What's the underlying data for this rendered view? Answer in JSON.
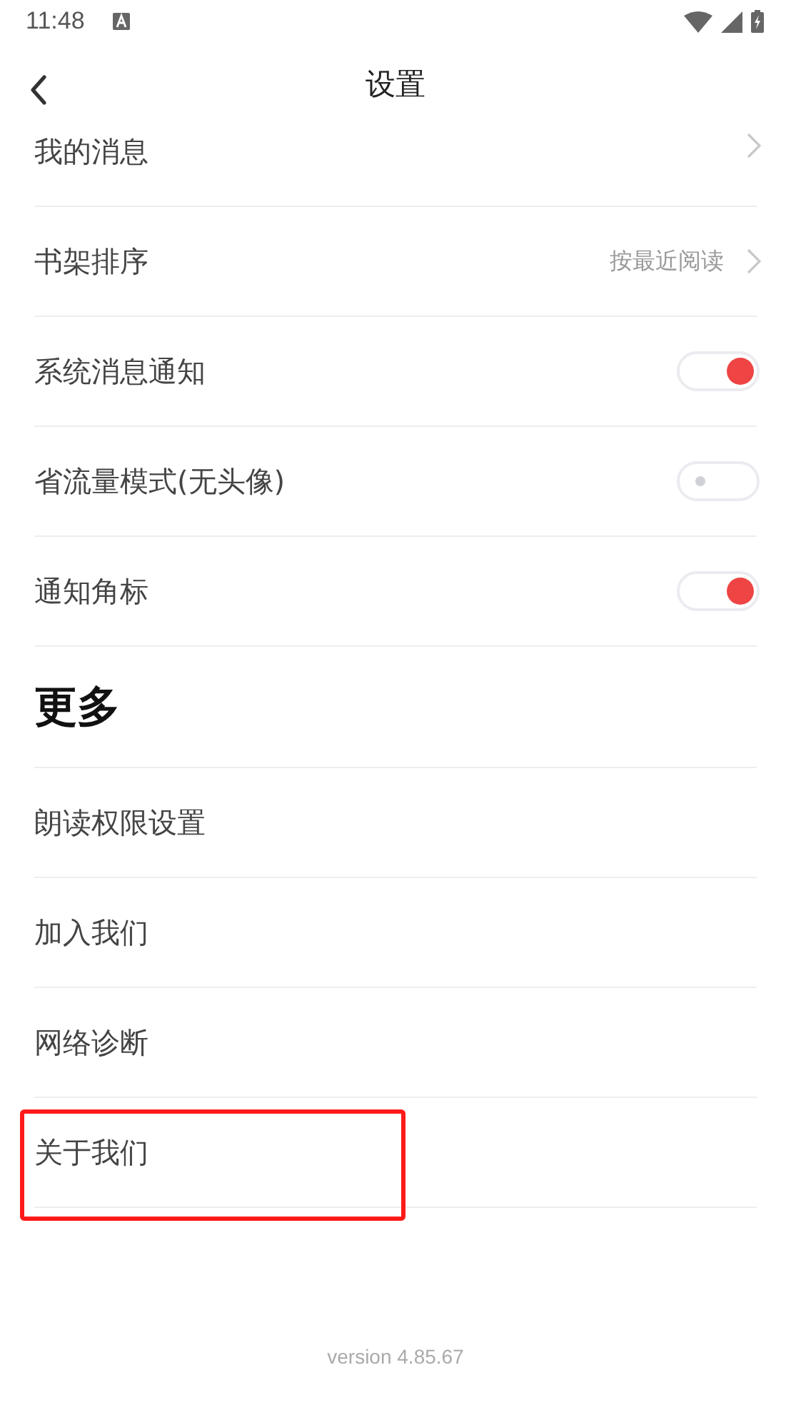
{
  "status_bar": {
    "time": "11:48"
  },
  "header": {
    "title": "设置"
  },
  "items": [
    {
      "kind": "link",
      "label": "我的消息",
      "highlighted": false
    },
    {
      "kind": "link",
      "label": "书架排序",
      "value": "按最近阅读",
      "highlighted": false
    },
    {
      "kind": "toggle",
      "label": "系统消息通知",
      "on": true,
      "highlighted": false
    },
    {
      "kind": "toggle",
      "label": "省流量模式(无头像)",
      "on": false,
      "highlighted": false
    },
    {
      "kind": "toggle",
      "label": "通知角标",
      "on": true,
      "highlighted": false
    },
    {
      "kind": "heading",
      "label": "更多"
    },
    {
      "kind": "plain",
      "label": "朗读权限设置",
      "highlighted": false
    },
    {
      "kind": "plain",
      "label": "加入我们",
      "highlighted": false
    },
    {
      "kind": "plain",
      "label": "网络诊断",
      "highlighted": false
    },
    {
      "kind": "plain",
      "label": "关于我们",
      "highlighted": true
    }
  ],
  "footer": {
    "version": "version 4.85.67"
  }
}
